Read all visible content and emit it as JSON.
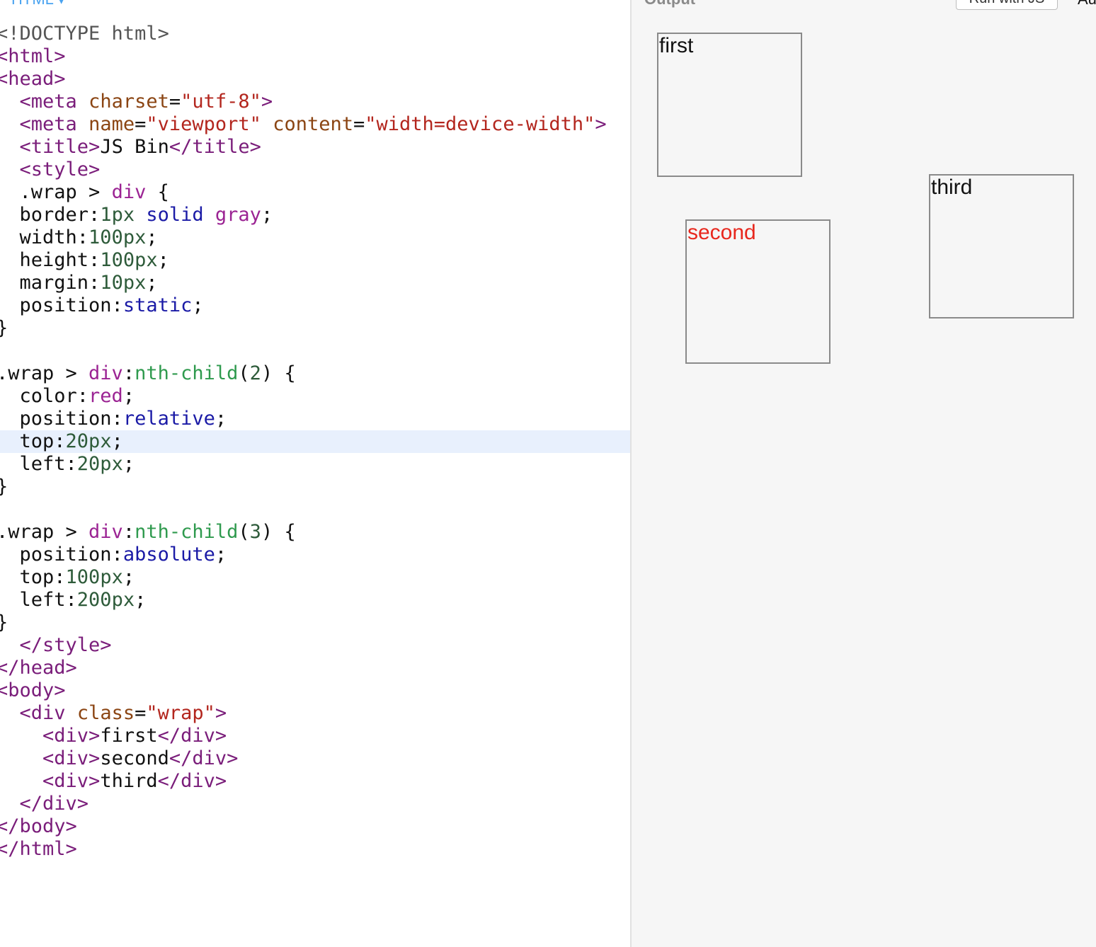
{
  "editor": {
    "tab_label": "HTML ▾",
    "lines": [
      [
        {
          "c": "doctype",
          "t": "<!DOCTYPE html>"
        }
      ],
      [
        {
          "c": "tag",
          "t": "<html>"
        }
      ],
      [
        {
          "c": "tag",
          "t": "<head>"
        }
      ],
      [
        {
          "c": "plain",
          "t": "  "
        },
        {
          "c": "tag",
          "t": "<meta"
        },
        {
          "c": "plain",
          "t": " "
        },
        {
          "c": "attr",
          "t": "charset"
        },
        {
          "c": "plain",
          "t": "="
        },
        {
          "c": "string",
          "t": "\"utf-8\""
        },
        {
          "c": "tag",
          "t": ">"
        }
      ],
      [
        {
          "c": "plain",
          "t": "  "
        },
        {
          "c": "tag",
          "t": "<meta"
        },
        {
          "c": "plain",
          "t": " "
        },
        {
          "c": "attr",
          "t": "name"
        },
        {
          "c": "plain",
          "t": "="
        },
        {
          "c": "string",
          "t": "\"viewport\""
        },
        {
          "c": "plain",
          "t": " "
        },
        {
          "c": "attr",
          "t": "content"
        },
        {
          "c": "plain",
          "t": "="
        },
        {
          "c": "string",
          "t": "\"width=device-width\""
        },
        {
          "c": "tag",
          "t": ">"
        }
      ],
      [
        {
          "c": "plain",
          "t": "  "
        },
        {
          "c": "tag",
          "t": "<title>"
        },
        {
          "c": "plain",
          "t": "JS Bin"
        },
        {
          "c": "tag",
          "t": "</title>"
        }
      ],
      [
        {
          "c": "plain",
          "t": "  "
        },
        {
          "c": "tag",
          "t": "<style>"
        }
      ],
      [
        {
          "c": "plain",
          "t": "  .wrap > "
        },
        {
          "c": "builtin",
          "t": "div"
        },
        {
          "c": "plain",
          "t": " {"
        }
      ],
      [
        {
          "c": "plain",
          "t": "  border:"
        },
        {
          "c": "number",
          "t": "1px"
        },
        {
          "c": "plain",
          "t": " "
        },
        {
          "c": "keyword",
          "t": "solid"
        },
        {
          "c": "plain",
          "t": " "
        },
        {
          "c": "builtin",
          "t": "gray"
        },
        {
          "c": "plain",
          "t": ";"
        }
      ],
      [
        {
          "c": "plain",
          "t": "  width:"
        },
        {
          "c": "number",
          "t": "100px"
        },
        {
          "c": "plain",
          "t": ";"
        }
      ],
      [
        {
          "c": "plain",
          "t": "  height:"
        },
        {
          "c": "number",
          "t": "100px"
        },
        {
          "c": "plain",
          "t": ";"
        }
      ],
      [
        {
          "c": "plain",
          "t": "  margin:"
        },
        {
          "c": "number",
          "t": "10px"
        },
        {
          "c": "plain",
          "t": ";"
        }
      ],
      [
        {
          "c": "plain",
          "t": "  position:"
        },
        {
          "c": "keyword",
          "t": "static"
        },
        {
          "c": "plain",
          "t": ";"
        }
      ],
      [
        {
          "c": "plain",
          "t": "}"
        }
      ],
      [],
      [
        {
          "c": "plain",
          "t": ".wrap > "
        },
        {
          "c": "builtin",
          "t": "div"
        },
        {
          "c": "plain",
          "t": ":"
        },
        {
          "c": "pseudo",
          "t": "nth-child"
        },
        {
          "c": "plain",
          "t": "("
        },
        {
          "c": "number",
          "t": "2"
        },
        {
          "c": "plain",
          "t": ") {"
        }
      ],
      [
        {
          "c": "plain",
          "t": "  color:"
        },
        {
          "c": "builtin",
          "t": "red"
        },
        {
          "c": "plain",
          "t": ";"
        }
      ],
      [
        {
          "c": "plain",
          "t": "  position:"
        },
        {
          "c": "keyword",
          "t": "relative"
        },
        {
          "c": "plain",
          "t": ";"
        }
      ],
      [
        {
          "c": "plain",
          "t": "  top:"
        },
        {
          "c": "number",
          "t": "20px"
        },
        {
          "c": "plain",
          "t": ";"
        }
      ],
      [
        {
          "c": "plain",
          "t": "  left:"
        },
        {
          "c": "number",
          "t": "20px"
        },
        {
          "c": "plain",
          "t": ";"
        }
      ],
      [
        {
          "c": "plain",
          "t": "}"
        }
      ],
      [],
      [
        {
          "c": "plain",
          "t": ".wrap > "
        },
        {
          "c": "builtin",
          "t": "div"
        },
        {
          "c": "plain",
          "t": ":"
        },
        {
          "c": "pseudo",
          "t": "nth-child"
        },
        {
          "c": "plain",
          "t": "("
        },
        {
          "c": "number",
          "t": "3"
        },
        {
          "c": "plain",
          "t": ") {"
        }
      ],
      [
        {
          "c": "plain",
          "t": "  position:"
        },
        {
          "c": "keyword",
          "t": "absolute"
        },
        {
          "c": "plain",
          "t": ";"
        }
      ],
      [
        {
          "c": "plain",
          "t": "  top:"
        },
        {
          "c": "number",
          "t": "100px"
        },
        {
          "c": "plain",
          "t": ";"
        }
      ],
      [
        {
          "c": "plain",
          "t": "  left:"
        },
        {
          "c": "number",
          "t": "200px"
        },
        {
          "c": "plain",
          "t": ";"
        }
      ],
      [
        {
          "c": "plain",
          "t": "}"
        }
      ],
      [
        {
          "c": "plain",
          "t": "  "
        },
        {
          "c": "tag",
          "t": "</style>"
        }
      ],
      [
        {
          "c": "tag",
          "t": "</head>"
        }
      ],
      [
        {
          "c": "tag",
          "t": "<body>"
        }
      ],
      [
        {
          "c": "plain",
          "t": "  "
        },
        {
          "c": "tag",
          "t": "<div"
        },
        {
          "c": "plain",
          "t": " "
        },
        {
          "c": "attr",
          "t": "class"
        },
        {
          "c": "plain",
          "t": "="
        },
        {
          "c": "string",
          "t": "\"wrap\""
        },
        {
          "c": "tag",
          "t": ">"
        }
      ],
      [
        {
          "c": "plain",
          "t": "    "
        },
        {
          "c": "tag",
          "t": "<div>"
        },
        {
          "c": "plain",
          "t": "first"
        },
        {
          "c": "tag",
          "t": "</div>"
        }
      ],
      [
        {
          "c": "plain",
          "t": "    "
        },
        {
          "c": "tag",
          "t": "<div>"
        },
        {
          "c": "plain",
          "t": "second"
        },
        {
          "c": "tag",
          "t": "</div>"
        }
      ],
      [
        {
          "c": "plain",
          "t": "    "
        },
        {
          "c": "tag",
          "t": "<div>"
        },
        {
          "c": "plain",
          "t": "third"
        },
        {
          "c": "tag",
          "t": "</div>"
        }
      ],
      [
        {
          "c": "plain",
          "t": "  "
        },
        {
          "c": "tag",
          "t": "</div>"
        }
      ],
      [
        {
          "c": "tag",
          "t": "</body>"
        }
      ],
      [
        {
          "c": "tag",
          "t": "</html>"
        }
      ]
    ],
    "active_line": 18
  },
  "output": {
    "label": "Output",
    "run_button_label": "Run with JS",
    "corner_text": "Au",
    "boxes": [
      {
        "text": "first"
      },
      {
        "text": "second",
        "color": "#e8281e"
      },
      {
        "text": "third"
      }
    ]
  },
  "colors": {
    "tag": "#7a1d7a",
    "attribute": "#8b4513",
    "string": "#b3261e",
    "number": "#2e5b3a",
    "keyword": "#1a1aa6",
    "builtin": "#9b2393",
    "pseudo": "#2f9a4e",
    "active_line_bg": "#e8f0fd",
    "output_bg": "#f6f6f6"
  }
}
